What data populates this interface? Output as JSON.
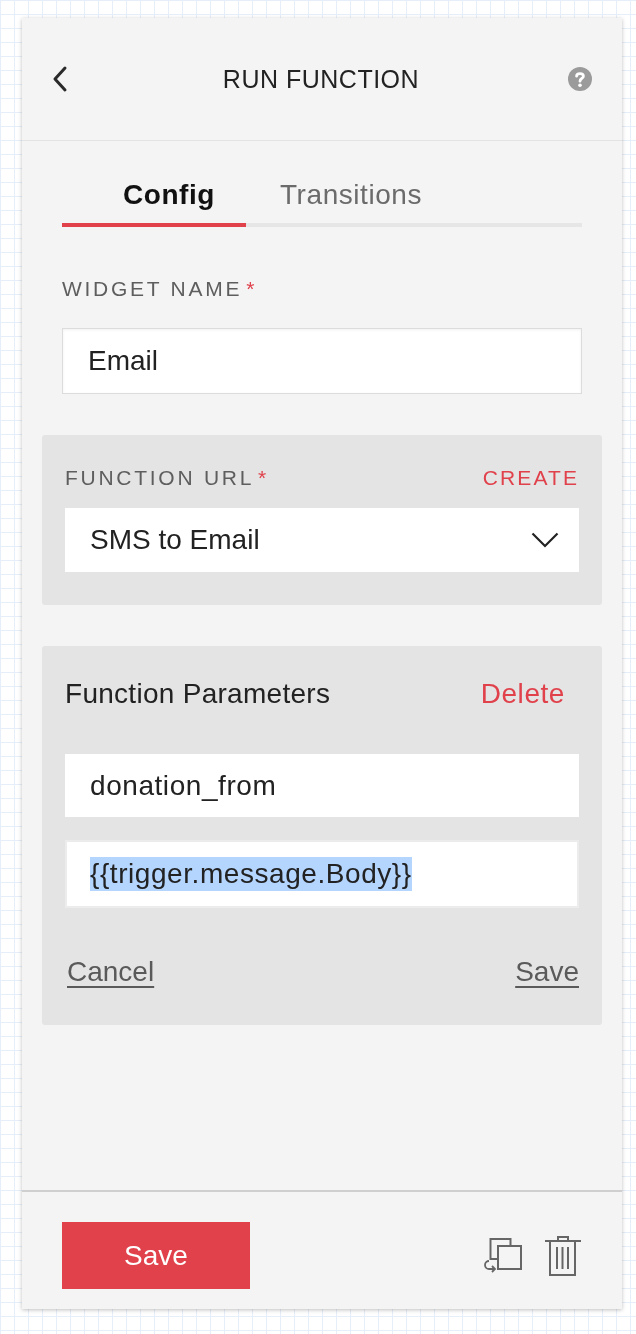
{
  "header": {
    "title": "RUN FUNCTION"
  },
  "tabs": [
    {
      "label": "Config",
      "selected": true
    },
    {
      "label": "Transitions",
      "selected": false
    }
  ],
  "widget_name": {
    "label": "WIDGET NAME",
    "required_mark": "*",
    "value": "Email"
  },
  "function_url": {
    "label": "FUNCTION URL",
    "required_mark": "*",
    "action": "CREATE",
    "value": "SMS to Email"
  },
  "function_parameters": {
    "title": "Function Parameters",
    "action": "Delete",
    "fields": [
      {
        "value": "donation_from",
        "focused": false
      },
      {
        "value": "{{trigger.message.Body}}",
        "focused": true
      }
    ],
    "cancel": "Cancel",
    "save": "Save"
  },
  "footer": {
    "save": "Save"
  }
}
